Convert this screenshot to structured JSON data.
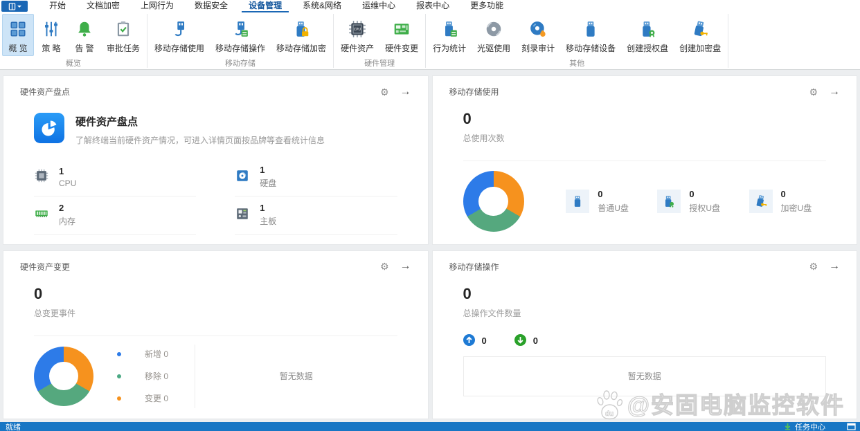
{
  "menu": {
    "tabs": [
      "开始",
      "文档加密",
      "上网行为",
      "数据安全",
      "设备管理",
      "系统&网络",
      "运维中心",
      "报表中心",
      "更多功能"
    ],
    "active_tab": "设备管理"
  },
  "ribbon": {
    "active_item": "概 览",
    "groups": [
      {
        "label": "概览",
        "items": [
          {
            "label": "概 览",
            "icon": "grid-icon"
          },
          {
            "label": "策 略",
            "icon": "sliders-icon"
          },
          {
            "label": "告 警",
            "icon": "bell-icon"
          },
          {
            "label": "审批任务",
            "icon": "clipboard-check-icon"
          }
        ]
      },
      {
        "label": "移动存储",
        "items": [
          {
            "label": "移动存储使用",
            "icon": "usb-plug-icon"
          },
          {
            "label": "移动存储操作",
            "icon": "usb-calendar-icon"
          },
          {
            "label": "移动存储加密",
            "icon": "usb-lock-icon"
          }
        ]
      },
      {
        "label": "硬件管理",
        "items": [
          {
            "label": "硬件资产",
            "icon": "cpu-chip-icon"
          },
          {
            "label": "硬件变更",
            "icon": "circuit-board-icon"
          }
        ]
      },
      {
        "label": "其他",
        "items": [
          {
            "label": "行为统计",
            "icon": "usb-stats-icon"
          },
          {
            "label": "光驱使用",
            "icon": "disc-icon"
          },
          {
            "label": "刻录审计",
            "icon": "disc-burn-icon"
          },
          {
            "label": "移动存储设备",
            "icon": "usb-device-icon"
          },
          {
            "label": "创建授权盘",
            "icon": "usb-badge-icon"
          },
          {
            "label": "创建加密盘",
            "icon": "usb-key-icon"
          }
        ]
      }
    ]
  },
  "cards": {
    "hardware_inventory": {
      "title": "硬件资产盘点",
      "feature_title": "硬件资产盘点",
      "feature_desc": "了解终端当前硬件资产情况，可进入详情页面按品牌等查看统计信息",
      "stats": [
        {
          "value": "1",
          "label": "CPU",
          "icon": "cpu-icon"
        },
        {
          "value": "1",
          "label": "硬盘",
          "icon": "hard-disk-icon"
        },
        {
          "value": "2",
          "label": "内存",
          "icon": "ram-icon"
        },
        {
          "value": "1",
          "label": "主板",
          "icon": "motherboard-icon"
        }
      ]
    },
    "storage_usage": {
      "title": "移动存储使用",
      "total_value": "0",
      "total_label": "总使用次数",
      "stats": [
        {
          "value": "0",
          "label": "普通U盘",
          "icon": "usb-plain-icon"
        },
        {
          "value": "0",
          "label": "授权U盘",
          "icon": "usb-authorized-icon"
        },
        {
          "value": "0",
          "label": "加密U盘",
          "icon": "usb-encrypted-icon"
        }
      ]
    },
    "hardware_change": {
      "title": "硬件资产变更",
      "total_value": "0",
      "total_label": "总变更事件",
      "legend": [
        {
          "label": "新增",
          "value": "0",
          "color": "#2d7be8"
        },
        {
          "label": "移除",
          "value": "0",
          "color": "#4ba984"
        },
        {
          "label": "变更",
          "value": "0",
          "color": "#f6921e"
        }
      ],
      "empty_text": "暂无数据"
    },
    "storage_ops": {
      "title": "移动存储操作",
      "total_value": "0",
      "total_label": "总操作文件数量",
      "upload_count": "0",
      "download_count": "0",
      "empty_text": "暂无数据"
    }
  },
  "chart_data": [
    {
      "type": "pie",
      "title": "移动存储使用",
      "labels": [
        "普通U盘",
        "授权U盘",
        "加密U盘"
      ],
      "values": [
        0,
        0,
        0
      ],
      "note": "all values zero - donut shown as equal placeholder thirds",
      "colors": [
        "#f6921e",
        "#55a87e",
        "#2d7be8"
      ],
      "segments_deg": [
        120,
        120,
        120
      ],
      "legend_position": "none"
    },
    {
      "type": "pie",
      "title": "硬件资产变更",
      "labels": [
        "新增",
        "移除",
        "变更"
      ],
      "values": [
        0,
        0,
        0
      ],
      "note": "all values zero - donut shown as equal placeholder thirds",
      "colors": [
        "#f6921e",
        "#55a87e",
        "#2d7be8"
      ],
      "segments_deg": [
        120,
        120,
        120
      ],
      "legend_position": "right"
    }
  ],
  "statusbar": {
    "ready": "就绪",
    "task_center": "任务中心"
  },
  "watermark": {
    "badge": "du",
    "text": "@安固电脑监控软件"
  },
  "colors": {
    "accent": "#1a67b5",
    "statusbar": "#1876c4",
    "donut_blue": "#2d7be8",
    "donut_orange": "#f6921e",
    "donut_green": "#55a87e"
  }
}
